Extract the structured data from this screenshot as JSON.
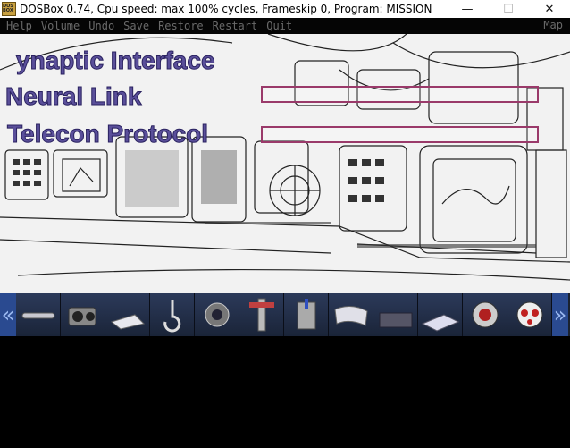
{
  "window": {
    "title": "DOSBox 0.74, Cpu speed: max 100% cycles, Frameskip  0, Program:  MISSION",
    "icon_text": "DOS BOX",
    "minimize_glyph": "—",
    "maximize_glyph": "☐",
    "close_glyph": "✕"
  },
  "menu": {
    "items": [
      "Help",
      "Volume",
      "Undo",
      "Save",
      "Restore",
      "Restart",
      "Quit"
    ],
    "map_label": "Map"
  },
  "overlay": {
    "lines": [
      "ynaptic Interface",
      "Neural Link",
      "Telecon Protocol"
    ],
    "neural_link_progress": 0.0,
    "telecon_protocol_progress": 0.0
  },
  "inventory": {
    "left_arrow": "«",
    "right_arrow": "»",
    "items": [
      "pipe-icon",
      "camera-icon",
      "paper-icon",
      "hook-icon",
      "diving-helmet-icon",
      "valve-icon",
      "device-icon",
      "scroll-icon",
      "panel-icon",
      "map-sheet-icon",
      "helmet-icon",
      "robot-head-icon"
    ]
  },
  "colors": {
    "overlay_text": "#5a4f9a",
    "progress_border": "#9a3a6a",
    "inventory_arrow": "#2a4a90"
  }
}
